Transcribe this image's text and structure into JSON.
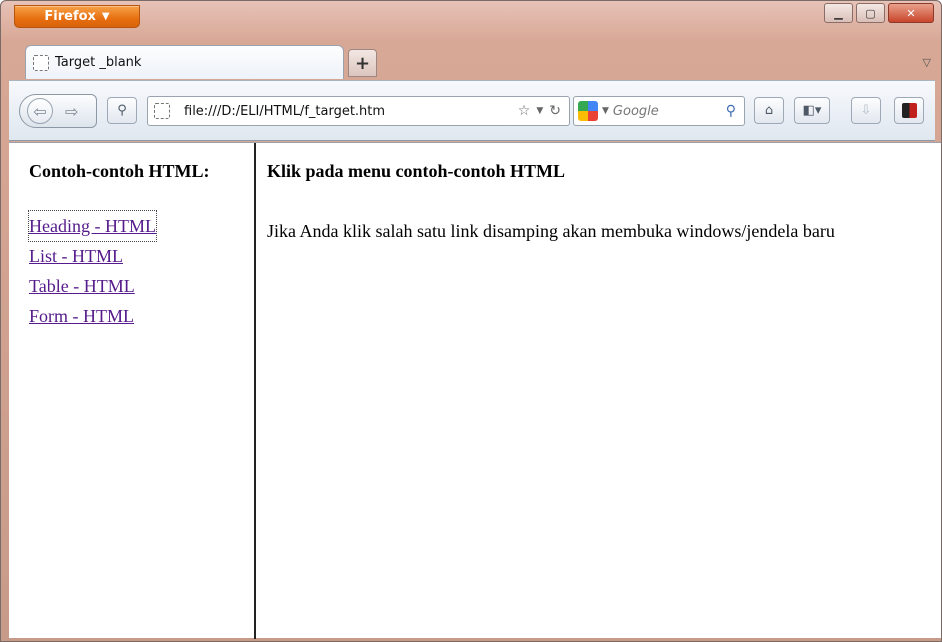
{
  "browser": {
    "menu_label": "Firefox",
    "tab_title": "Target _blank",
    "new_tab_label": "+",
    "url": "file:///D:/ELI/HTML/f_target.htm",
    "search_placeholder": "Google"
  },
  "left_frame": {
    "heading": "Contoh-contoh HTML:",
    "links": [
      {
        "label": "Heading - HTML"
      },
      {
        "label": "List - HTML"
      },
      {
        "label": "Table - HTML"
      },
      {
        "label": "Form - HTML"
      }
    ]
  },
  "right_frame": {
    "heading": "Klik pada menu contoh-contoh HTML",
    "body": "Jika Anda klik salah satu link disamping akan membuka windows/jendela baru"
  },
  "icons": {
    "firefox_caret": "chevron-down-icon",
    "minimize": "minimize-icon",
    "maximize": "maximize-icon",
    "close": "close-icon",
    "bookmark_star": "star-icon",
    "reload": "reload-icon",
    "search": "search-icon",
    "home": "home-icon",
    "addons": "puzzle-icon",
    "downloads": "download-icon",
    "extension": "extension-icon"
  },
  "colors": {
    "firefox_button": "#e76f10",
    "link_visited": "#551a8b",
    "frame_divider": "#222222"
  }
}
